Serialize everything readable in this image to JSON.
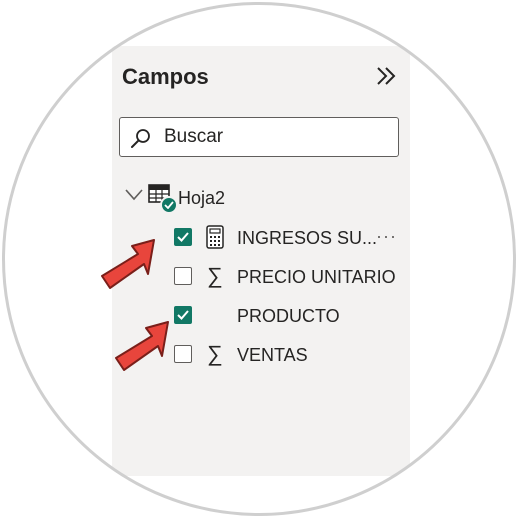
{
  "panel": {
    "title": "Campos",
    "collapse_icon": "double-chevron-right-icon"
  },
  "search": {
    "placeholder": "Buscar",
    "icon": "search-icon"
  },
  "table": {
    "name": "Hoja2",
    "expanded": true,
    "icon": "table-icon",
    "badge_icon": "check-badge-icon"
  },
  "fields": [
    {
      "label": "INGRESOS SU...",
      "checked": true,
      "icon": "calculator-icon",
      "more": "···"
    },
    {
      "label": "PRECIO UNITARIO",
      "checked": false,
      "icon": "sigma-icon"
    },
    {
      "label": "PRODUCTO",
      "checked": true,
      "icon": ""
    },
    {
      "label": "VENTAS",
      "checked": false,
      "icon": "sigma-icon"
    }
  ],
  "colors": {
    "panel_bg": "#f3f2f1",
    "accent": "#117865",
    "annotation_arrow": "#e8453c",
    "ring": "#cfcfcf"
  }
}
